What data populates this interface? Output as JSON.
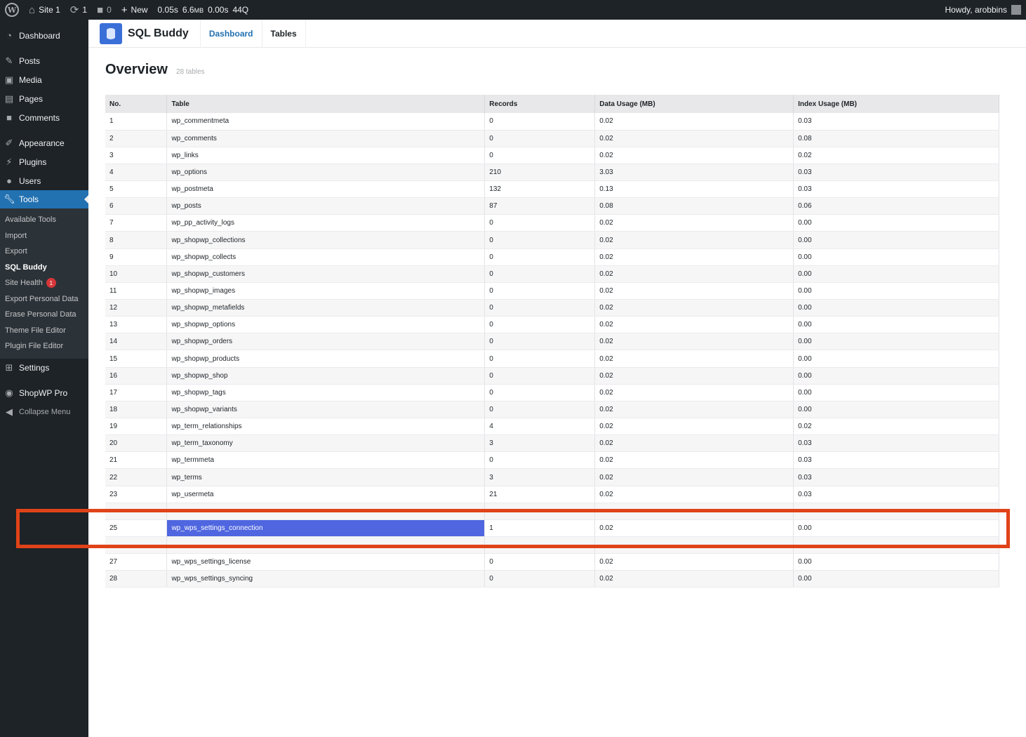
{
  "admin_bar": {
    "site_name": "Site 1",
    "updates_count": "1",
    "comments_count": "0",
    "new_label": "New",
    "qm_time": "0.05s",
    "qm_memory": "6.6",
    "qm_memory_unit": "MB",
    "qm_db_time": "0.00s",
    "qm_queries": "44Q",
    "howdy": "Howdy, arobbins"
  },
  "sidebar": {
    "dashboard": "Dashboard",
    "posts": "Posts",
    "media": "Media",
    "pages": "Pages",
    "comments": "Comments",
    "appearance": "Appearance",
    "plugins": "Plugins",
    "users": "Users",
    "tools": "Tools",
    "tools_sub": {
      "available_tools": "Available Tools",
      "import": "Import",
      "export": "Export",
      "sql_buddy": "SQL Buddy",
      "site_health": "Site Health",
      "site_health_badge": "1",
      "export_personal_data": "Export Personal Data",
      "erase_personal_data": "Erase Personal Data",
      "theme_file_editor": "Theme File Editor",
      "plugin_file_editor": "Plugin File Editor"
    },
    "settings": "Settings",
    "shopwp": "ShopWP Pro",
    "collapse": "Collapse Menu"
  },
  "plugin": {
    "title": "SQL Buddy",
    "tab_dashboard": "Dashboard",
    "tab_tables": "Tables"
  },
  "overview": {
    "title": "Overview",
    "subtitle": "28 tables"
  },
  "table": {
    "headers": [
      "No.",
      "Table",
      "Records",
      "Data Usage (MB)",
      "Index Usage (MB)"
    ],
    "rows": [
      [
        "1",
        "wp_commentmeta",
        "0",
        "0.02",
        "0.03"
      ],
      [
        "2",
        "wp_comments",
        "0",
        "0.02",
        "0.08"
      ],
      [
        "3",
        "wp_links",
        "0",
        "0.02",
        "0.02"
      ],
      [
        "4",
        "wp_options",
        "210",
        "3.03",
        "0.03"
      ],
      [
        "5",
        "wp_postmeta",
        "132",
        "0.13",
        "0.03"
      ],
      [
        "6",
        "wp_posts",
        "87",
        "0.08",
        "0.06"
      ],
      [
        "7",
        "wp_pp_activity_logs",
        "0",
        "0.02",
        "0.00"
      ],
      [
        "8",
        "wp_shopwp_collections",
        "0",
        "0.02",
        "0.00"
      ],
      [
        "9",
        "wp_shopwp_collects",
        "0",
        "0.02",
        "0.00"
      ],
      [
        "10",
        "wp_shopwp_customers",
        "0",
        "0.02",
        "0.00"
      ],
      [
        "11",
        "wp_shopwp_images",
        "0",
        "0.02",
        "0.00"
      ],
      [
        "12",
        "wp_shopwp_metafields",
        "0",
        "0.02",
        "0.00"
      ],
      [
        "13",
        "wp_shopwp_options",
        "0",
        "0.02",
        "0.00"
      ],
      [
        "14",
        "wp_shopwp_orders",
        "0",
        "0.02",
        "0.00"
      ],
      [
        "15",
        "wp_shopwp_products",
        "0",
        "0.02",
        "0.00"
      ],
      [
        "16",
        "wp_shopwp_shop",
        "0",
        "0.02",
        "0.00"
      ],
      [
        "17",
        "wp_shopwp_tags",
        "0",
        "0.02",
        "0.00"
      ],
      [
        "18",
        "wp_shopwp_variants",
        "0",
        "0.02",
        "0.00"
      ],
      [
        "19",
        "wp_term_relationships",
        "4",
        "0.02",
        "0.02"
      ],
      [
        "20",
        "wp_term_taxonomy",
        "3",
        "0.02",
        "0.03"
      ],
      [
        "21",
        "wp_termmeta",
        "0",
        "0.02",
        "0.03"
      ],
      [
        "22",
        "wp_terms",
        "3",
        "0.02",
        "0.03"
      ],
      [
        "23",
        "wp_usermeta",
        "21",
        "0.02",
        "0.03"
      ],
      [
        "",
        "",
        "",
        "",
        ""
      ],
      [
        "25",
        "wp_wps_settings_connection",
        "1",
        "0.02",
        "0.00"
      ],
      [
        "",
        "",
        "",
        "",
        ""
      ],
      [
        "27",
        "wp_wps_settings_license",
        "0",
        "0.02",
        "0.00"
      ],
      [
        "28",
        "wp_wps_settings_syncing",
        "0",
        "0.02",
        "0.00"
      ]
    ],
    "selected_index": 24
  },
  "colors": {
    "admin_dark": "#1d2327",
    "wp_blue": "#2271b1",
    "selected_row": "#4f66e0",
    "highlight_box": "#e04318"
  }
}
